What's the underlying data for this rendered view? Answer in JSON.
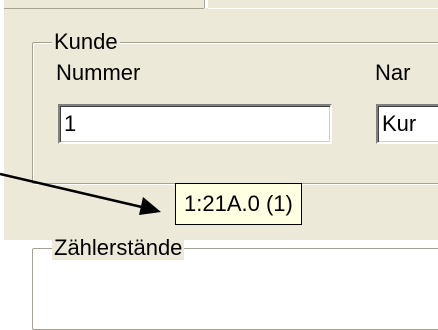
{
  "group_customer": {
    "title": "Kunde",
    "number_label": "Nummer",
    "number_value": "1",
    "name_label": "Nar",
    "name_value": "Kur"
  },
  "tooltip": {
    "text": "1:21A.0 (1)"
  },
  "group_meter": {
    "title": "Zählerstände"
  }
}
